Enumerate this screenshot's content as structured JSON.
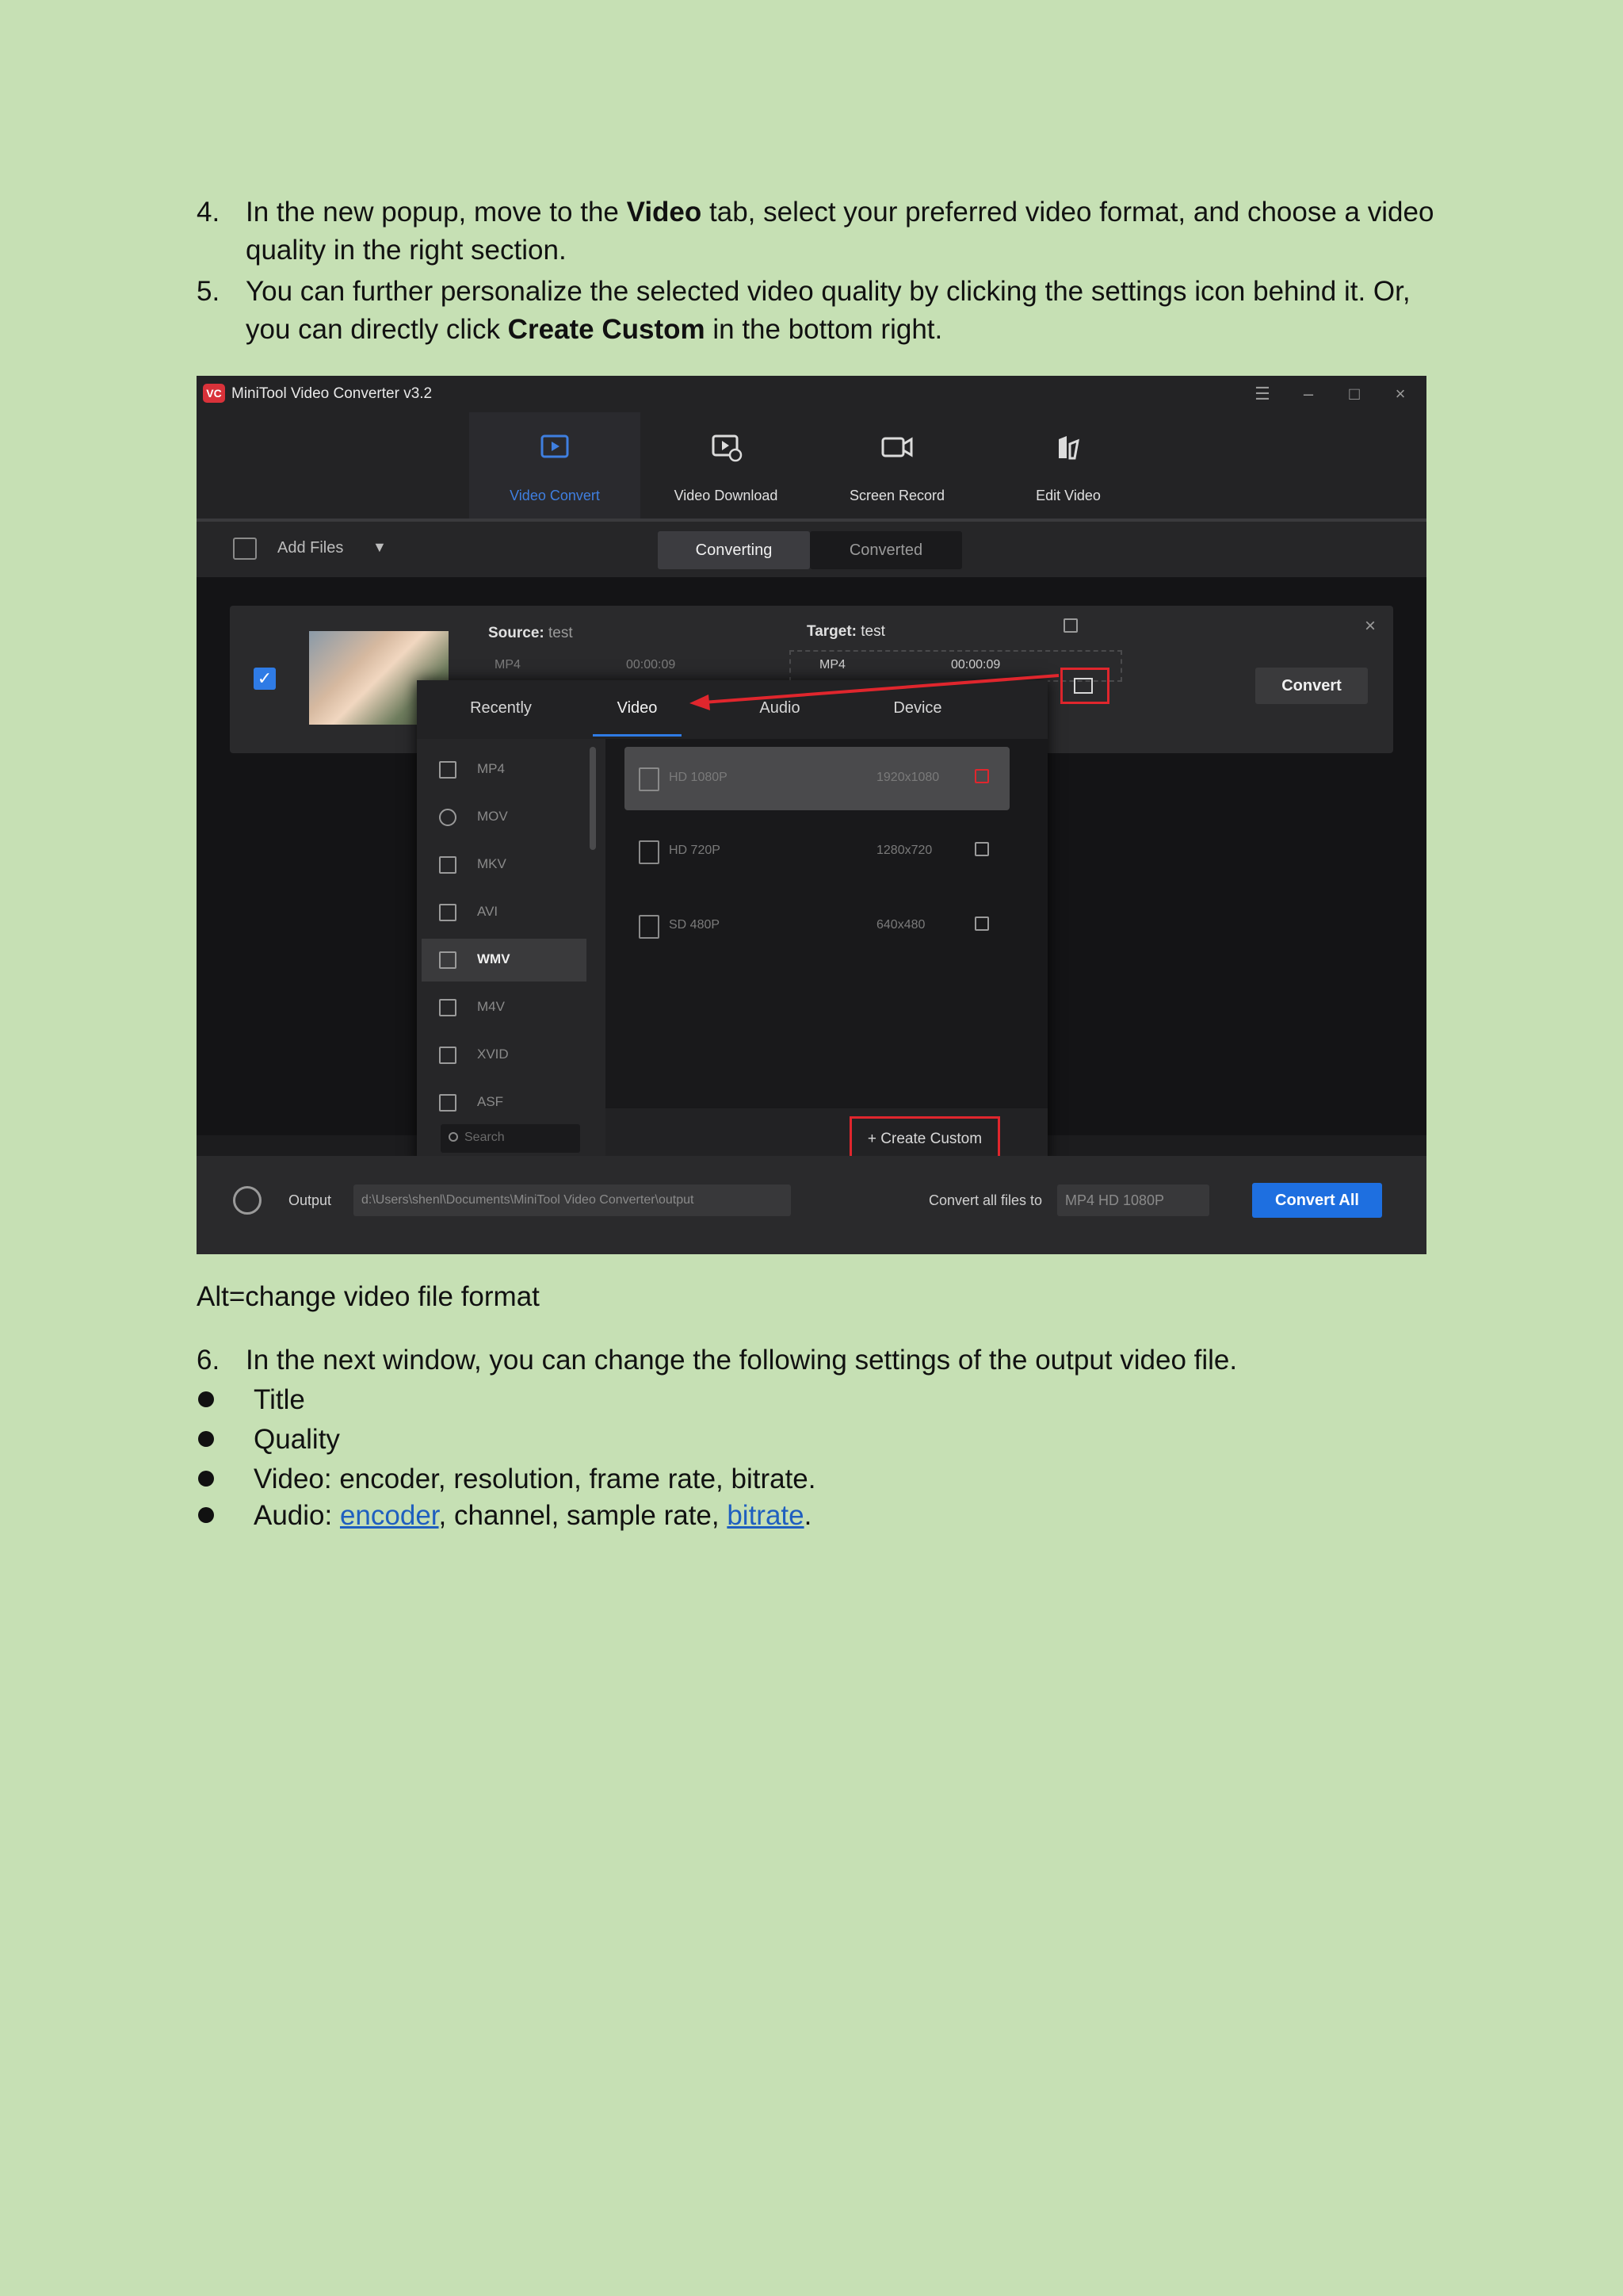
{
  "steps": [
    {
      "num": "4.",
      "before": "In the new popup, move to the ",
      "bold": "Video",
      "after": " tab, select your preferred video format, and choose a video quality in the right section."
    },
    {
      "num": "5.",
      "before": "You can further personalize the selected video quality by clicking the settings icon behind it. Or, you can directly click ",
      "bold": "Create Custom",
      "after": " in the bottom right."
    },
    {
      "num": "6.",
      "text": "In the next window, you can change the following settings of the output video file."
    }
  ],
  "alt_text": "Alt=change video file format",
  "bullets": [
    {
      "text": "Title"
    },
    {
      "text": "Quality"
    },
    {
      "text": "Video: encoder, resolution, frame rate, bitrate."
    },
    {
      "prefix": "Audio: ",
      "link1": "encoder",
      "middle": ", channel, sample rate, ",
      "link2": "bitrate",
      "suffix": "."
    }
  ],
  "app": {
    "logo": "VC",
    "title": "MiniTool Video Converter v3.2",
    "window_icons": [
      "menu-icon",
      "minimize-icon",
      "maximize-icon",
      "close-icon"
    ],
    "nav": [
      {
        "label": "Video Convert",
        "icon": "video-convert-icon",
        "active": true
      },
      {
        "label": "Video Download",
        "icon": "video-download-icon"
      },
      {
        "label": "Screen Record",
        "icon": "screen-record-icon"
      },
      {
        "label": "Edit Video",
        "icon": "edit-video-icon"
      }
    ],
    "toolbar": {
      "add_files": "Add Files",
      "tab_converting": "Converting",
      "tab_converted": "Converted"
    },
    "file": {
      "source_label": "Source:",
      "source_name": "test",
      "source_format": "MP4",
      "source_duration": "00:00:09",
      "target_label": "Target:",
      "target_name": "test",
      "target_format": "MP4",
      "target_duration": "00:00:09",
      "convert": "Convert"
    },
    "popup": {
      "tabs": [
        "Recently",
        "Video",
        "Audio",
        "Device"
      ],
      "active_tab": "Video",
      "formats": [
        "MP4",
        "MOV",
        "MKV",
        "AVI",
        "WMV",
        "M4V",
        "XVID",
        "ASF"
      ],
      "selected_format": "WMV",
      "search_placeholder": "Search",
      "qualities": [
        {
          "name": "HD 1080P",
          "res": "1920x1080",
          "selected": true
        },
        {
          "name": "HD 720P",
          "res": "1280x720"
        },
        {
          "name": "SD 480P",
          "res": "640x480"
        }
      ],
      "create_custom": "+ Create Custom"
    },
    "bottom": {
      "output_label": "Output",
      "output_path": "d:\\Users\\shenl\\Documents\\MiniTool Video Converter\\output",
      "convert_all_label": "Convert all files to",
      "convert_all_value": "MP4 HD 1080P",
      "convert_all_button": "Convert All"
    },
    "accent": "#2f7be5",
    "highlight": "#e0262d"
  }
}
